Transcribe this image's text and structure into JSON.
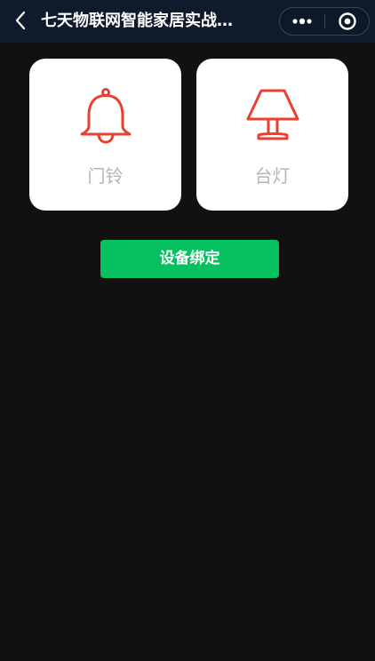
{
  "navbar": {
    "title": "七天物联网智能家居实战…",
    "back_icon": "chevron-left-icon",
    "more_icon": "more-dots-icon",
    "close_icon": "target-circle-icon"
  },
  "devices": [
    {
      "label": "门铃",
      "icon": "bell-icon",
      "icon_color": "#e8412f"
    },
    {
      "label": "台灯",
      "icon": "table-lamp-icon",
      "icon_color": "#e8412f"
    }
  ],
  "actions": {
    "bind_label": "设备绑定"
  },
  "colors": {
    "background": "#111111",
    "navbar": "#0f1b2c",
    "card": "#ffffff",
    "accent": "#07c160",
    "icon": "#e8412f"
  }
}
